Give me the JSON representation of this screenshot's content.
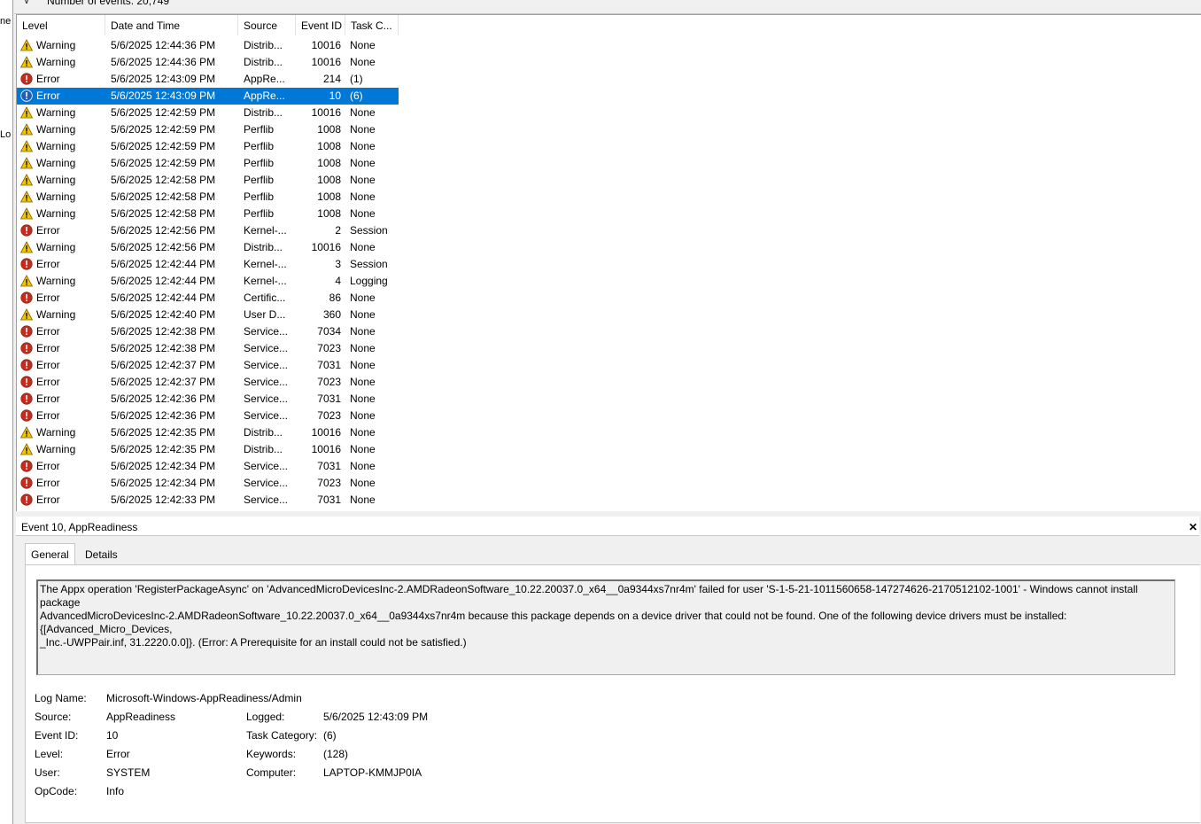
{
  "topbar": {
    "filter_glyph": "⊽",
    "count_text": "Number of events: 20,749"
  },
  "left_strip": {
    "frag_top": "ne",
    "frag_mid": "Lo"
  },
  "list": {
    "columns": [
      "Level",
      "Date and Time",
      "Source",
      "Event ID",
      "Task C..."
    ],
    "rows": [
      {
        "level": "Warning",
        "date": "5/6/2025 12:44:36 PM",
        "source": "Distrib...",
        "id": "10016",
        "task": "None",
        "icon": "warning"
      },
      {
        "level": "Warning",
        "date": "5/6/2025 12:44:36 PM",
        "source": "Distrib...",
        "id": "10016",
        "task": "None",
        "icon": "warning"
      },
      {
        "level": "Error",
        "date": "5/6/2025 12:43:09 PM",
        "source": "AppRe...",
        "id": "214",
        "task": "(1)",
        "icon": "error"
      },
      {
        "level": "Error",
        "date": "5/6/2025 12:43:09 PM",
        "source": "AppRe...",
        "id": "10",
        "task": "(6)",
        "icon": "error",
        "selected": true
      },
      {
        "level": "Warning",
        "date": "5/6/2025 12:42:59 PM",
        "source": "Distrib...",
        "id": "10016",
        "task": "None",
        "icon": "warning"
      },
      {
        "level": "Warning",
        "date": "5/6/2025 12:42:59 PM",
        "source": "Perflib",
        "id": "1008",
        "task": "None",
        "icon": "warning"
      },
      {
        "level": "Warning",
        "date": "5/6/2025 12:42:59 PM",
        "source": "Perflib",
        "id": "1008",
        "task": "None",
        "icon": "warning"
      },
      {
        "level": "Warning",
        "date": "5/6/2025 12:42:59 PM",
        "source": "Perflib",
        "id": "1008",
        "task": "None",
        "icon": "warning"
      },
      {
        "level": "Warning",
        "date": "5/6/2025 12:42:58 PM",
        "source": "Perflib",
        "id": "1008",
        "task": "None",
        "icon": "warning"
      },
      {
        "level": "Warning",
        "date": "5/6/2025 12:42:58 PM",
        "source": "Perflib",
        "id": "1008",
        "task": "None",
        "icon": "warning"
      },
      {
        "level": "Warning",
        "date": "5/6/2025 12:42:58 PM",
        "source": "Perflib",
        "id": "1008",
        "task": "None",
        "icon": "warning"
      },
      {
        "level": "Error",
        "date": "5/6/2025 12:42:56 PM",
        "source": "Kernel-...",
        "id": "2",
        "task": "Session",
        "icon": "error"
      },
      {
        "level": "Warning",
        "date": "5/6/2025 12:42:56 PM",
        "source": "Distrib...",
        "id": "10016",
        "task": "None",
        "icon": "warning"
      },
      {
        "level": "Error",
        "date": "5/6/2025 12:42:44 PM",
        "source": "Kernel-...",
        "id": "3",
        "task": "Session",
        "icon": "error"
      },
      {
        "level": "Warning",
        "date": "5/6/2025 12:42:44 PM",
        "source": "Kernel-...",
        "id": "4",
        "task": "Logging",
        "icon": "warning"
      },
      {
        "level": "Error",
        "date": "5/6/2025 12:42:44 PM",
        "source": "Certific...",
        "id": "86",
        "task": "None",
        "icon": "error"
      },
      {
        "level": "Warning",
        "date": "5/6/2025 12:42:40 PM",
        "source": "User D...",
        "id": "360",
        "task": "None",
        "icon": "warning"
      },
      {
        "level": "Error",
        "date": "5/6/2025 12:42:38 PM",
        "source": "Service...",
        "id": "7034",
        "task": "None",
        "icon": "error"
      },
      {
        "level": "Error",
        "date": "5/6/2025 12:42:38 PM",
        "source": "Service...",
        "id": "7023",
        "task": "None",
        "icon": "error"
      },
      {
        "level": "Error",
        "date": "5/6/2025 12:42:37 PM",
        "source": "Service...",
        "id": "7031",
        "task": "None",
        "icon": "error"
      },
      {
        "level": "Error",
        "date": "5/6/2025 12:42:37 PM",
        "source": "Service...",
        "id": "7023",
        "task": "None",
        "icon": "error"
      },
      {
        "level": "Error",
        "date": "5/6/2025 12:42:36 PM",
        "source": "Service...",
        "id": "7031",
        "task": "None",
        "icon": "error"
      },
      {
        "level": "Error",
        "date": "5/6/2025 12:42:36 PM",
        "source": "Service...",
        "id": "7023",
        "task": "None",
        "icon": "error"
      },
      {
        "level": "Warning",
        "date": "5/6/2025 12:42:35 PM",
        "source": "Distrib...",
        "id": "10016",
        "task": "None",
        "icon": "warning"
      },
      {
        "level": "Warning",
        "date": "5/6/2025 12:42:35 PM",
        "source": "Distrib...",
        "id": "10016",
        "task": "None",
        "icon": "warning"
      },
      {
        "level": "Error",
        "date": "5/6/2025 12:42:34 PM",
        "source": "Service...",
        "id": "7031",
        "task": "None",
        "icon": "error"
      },
      {
        "level": "Error",
        "date": "5/6/2025 12:42:34 PM",
        "source": "Service...",
        "id": "7023",
        "task": "None",
        "icon": "error"
      },
      {
        "level": "Error",
        "date": "5/6/2025 12:42:33 PM",
        "source": "Service...",
        "id": "7031",
        "task": "None",
        "icon": "error"
      }
    ]
  },
  "detail": {
    "title": "Event 10, AppReadiness",
    "close_glyph": "✕",
    "tabs": [
      "General",
      "Details"
    ],
    "message_line1": "The Appx operation 'RegisterPackageAsync' on 'AdvancedMicroDevicesInc-2.AMDRadeonSoftware_10.22.20037.0_x64__0a9344xs7nr4m' failed for user 'S-1-5-21-1011560658-147274626-2170512102-1001' - Windows cannot install package",
    "message_line2": "AdvancedMicroDevicesInc-2.AMDRadeonSoftware_10.22.20037.0_x64__0a9344xs7nr4m because this package depends on a device driver that could not be found.  One of the following device drivers must be installed: {[Advanced_Micro_Devices,",
    "message_line3": "_Inc.-UWPPair.inf, 31.2220.0.0]}. (Error: A Prerequisite for an install could not be satisfied.)",
    "fields": {
      "log_name_label": "Log Name:",
      "log_name": "Microsoft-Windows-AppReadiness/Admin",
      "source_label": "Source:",
      "source": "AppReadiness",
      "logged_label": "Logged:",
      "logged": "5/6/2025 12:43:09 PM",
      "event_id_label": "Event ID:",
      "event_id": "10",
      "task_category_label": "Task Category:",
      "task_category": "(6)",
      "level_label": "Level:",
      "level": "Error",
      "keywords_label": "Keywords:",
      "keywords": "(128)",
      "user_label": "User:",
      "user": "SYSTEM",
      "computer_label": "Computer:",
      "computer": "LAPTOP-KMMJP0IA",
      "opcode_label": "OpCode:",
      "opcode": "Info"
    }
  },
  "colors": {
    "selection": "#0078d7",
    "warning": "#f5c400",
    "error": "#c42b1c",
    "info": "#1e5fb5"
  }
}
